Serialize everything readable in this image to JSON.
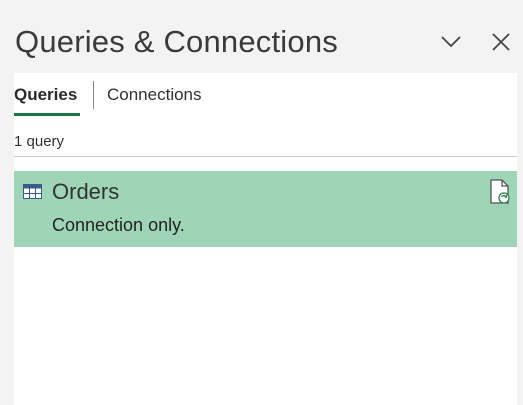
{
  "pane": {
    "title": "Queries & Connections",
    "chevron_icon": "chevron-down-icon",
    "close_icon": "close-icon"
  },
  "tabs": [
    {
      "label": "Queries",
      "active": true
    },
    {
      "label": "Connections",
      "active": false
    }
  ],
  "query_count": "1 query",
  "queries": [
    {
      "name": "Orders",
      "status": "Connection only.",
      "icon": "table-icon",
      "action_icon": "refresh-document-icon"
    }
  ],
  "colors": {
    "accent": "#217346",
    "selected_row": "#9fd5b7",
    "pane_bg": "#f3f3f3"
  }
}
